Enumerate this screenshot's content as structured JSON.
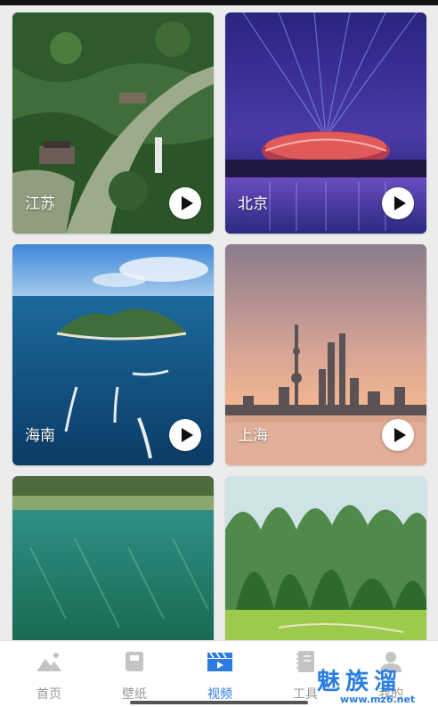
{
  "cards": [
    {
      "label": "江苏"
    },
    {
      "label": "北京"
    },
    {
      "label": "海南"
    },
    {
      "label": "上海"
    },
    {
      "label": ""
    },
    {
      "label": ""
    }
  ],
  "tabs": [
    {
      "label": "首页",
      "icon": "mountain-icon",
      "active": false
    },
    {
      "label": "壁纸",
      "icon": "wallpaper-icon",
      "active": false
    },
    {
      "label": "视频",
      "icon": "video-clapper-icon",
      "active": true
    },
    {
      "label": "工具",
      "icon": "notebook-icon",
      "active": false
    },
    {
      "label": "我的",
      "icon": "user-icon",
      "active": false
    }
  ],
  "watermark": {
    "text": "魅族溜",
    "url": "www.mz6.net"
  },
  "colors": {
    "accent": "#2b7be0",
    "inactive": "#999999",
    "background": "#ececec"
  }
}
